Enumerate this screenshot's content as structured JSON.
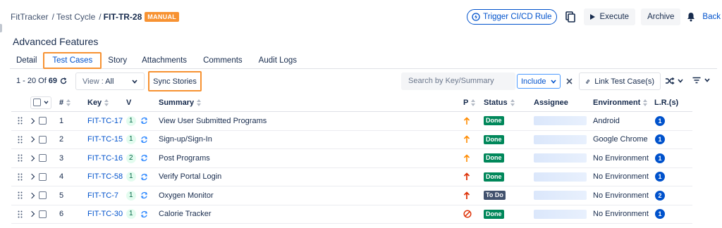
{
  "header": {
    "breadcrumb": [
      "FitTracker",
      "Test Cycle",
      "FIT-TR-28"
    ],
    "breadcrumb_sep": "/",
    "badge": "MANUAL",
    "actions": {
      "trigger_label": "Trigger CI/CD Rule",
      "execute_label": "Execute",
      "archive_label": "Archive",
      "back_label": "Back"
    }
  },
  "page_title": "Advanced Features",
  "tabs": [
    {
      "label": "Detail",
      "active": false
    },
    {
      "label": "Test Cases",
      "active": true
    },
    {
      "label": "Story",
      "active": false
    },
    {
      "label": "Attachments",
      "active": false
    },
    {
      "label": "Comments",
      "active": false
    },
    {
      "label": "Audit Logs",
      "active": false
    }
  ],
  "toolbar": {
    "pager_range": "1 - 20",
    "pager_of": "Of",
    "pager_total": "69",
    "view_label": "View :",
    "view_value": "All",
    "sync_label": "Sync Stories",
    "search_placeholder": "Search by Key/Summary",
    "include_value": "Include",
    "link_label": "Link Test Case(s)"
  },
  "table": {
    "columns": {
      "num": "#",
      "key": "Key",
      "v": "V",
      "summary": "Summary",
      "p": "P",
      "status": "Status",
      "assignee": "Assignee",
      "environment": "Environment",
      "lr": "L.R.(s)"
    },
    "rows": [
      {
        "num": "1",
        "key": "FIT-TC-17",
        "version": "1",
        "summary": "View User Submitted Programs",
        "priority": "up-orange",
        "status": "Done",
        "environment": "Android",
        "lr": "1"
      },
      {
        "num": "2",
        "key": "FIT-TC-15",
        "version": "1",
        "summary": "Sign-up/Sign-In",
        "priority": "up-orange",
        "status": "Done",
        "environment": "Google Chrome",
        "lr": "1"
      },
      {
        "num": "3",
        "key": "FIT-TC-16",
        "version": "2",
        "summary": "Post Programs",
        "priority": "up-orange",
        "status": "Done",
        "environment": "No Environment",
        "lr": "1"
      },
      {
        "num": "4",
        "key": "FIT-TC-58",
        "version": "1",
        "summary": "Verify Portal Login",
        "priority": "up-red",
        "status": "Done",
        "environment": "No Environment",
        "lr": "1"
      },
      {
        "num": "5",
        "key": "FIT-TC-7",
        "version": "1",
        "summary": "Oxygen Monitor",
        "priority": "up-red",
        "status": "To Do",
        "environment": "No Environment",
        "lr": "2"
      },
      {
        "num": "6",
        "key": "FIT-TC-30",
        "version": "1",
        "summary": "Calorie Tracker",
        "priority": "blocker",
        "status": "Done",
        "environment": "No Environment",
        "lr": "1"
      }
    ]
  },
  "colors": {
    "accent": "#0052cc",
    "highlight": "#f79232",
    "done": "#00875a",
    "todo": "#42526e"
  }
}
